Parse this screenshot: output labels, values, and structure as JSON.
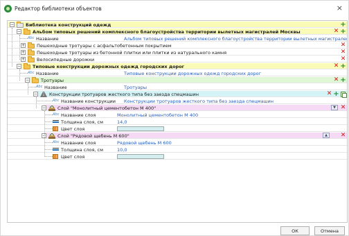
{
  "window": {
    "title": "Редактор библиотеки объектов",
    "close_glyph": "×",
    "app_icon": "app-globe-icon"
  },
  "tree": {
    "root": {
      "label": "Библиотека конструкций одежд",
      "expander": "−"
    },
    "album": {
      "label": "Альбом типовых решений комплексного благоустройства территории вылетных магистралей Москвы",
      "expander": "−"
    },
    "album_name": {
      "label": "Название",
      "value": "Альбом типовых решений комплексного благоустройства территории вылетных магистралей Москвы"
    },
    "group1": {
      "label": "Пешеходные тротуары с асфальтобетонным покрытием",
      "expander": "+"
    },
    "group2": {
      "label": "Пешеходные тротуары из бетонной плитки или плитки из натурального камня",
      "expander": "+"
    },
    "group3": {
      "label": "Велосипедные дорожки",
      "expander": "+"
    },
    "typical": {
      "label": "Типовые конструкции дорожных одежд городских дорог",
      "expander": "−"
    },
    "typical_name": {
      "label": "Название",
      "value": "Типовые конструкции дорожных одежд городских дорог"
    },
    "sidewalks": {
      "label": "Тротуары",
      "expander": "−"
    },
    "sidewalks_name": {
      "label": "Название",
      "value": "Тротуары"
    },
    "construction": {
      "label": "Конструкции тротуаров жесткого типа без заезда спецмашин",
      "expander": "−"
    },
    "construction_name": {
      "label": "Название конструкции",
      "value": "Конструкции тротуаров жесткого типа без заезда спецмашин"
    },
    "layer1": {
      "label": "Слой \"Монолитный цементобетон М 400\"",
      "expander": "−"
    },
    "layer1_name": {
      "label": "Название слоя",
      "value": "Монолитный цементобетон М 400"
    },
    "layer1_thickness": {
      "label": "Толщина слоя, см",
      "value": "14,0"
    },
    "layer1_color": {
      "label": "Цвет слоя",
      "swatch": "#d6eef0"
    },
    "layer2": {
      "label": "Слой \"Рядовой щебень М 600\"",
      "expander": "−"
    },
    "layer2_name": {
      "label": "Название слоя",
      "value": "Рядовой щебень М 600"
    },
    "layer2_thickness": {
      "label": "Толщина слоя, см",
      "value": "10,0"
    },
    "layer2_color": {
      "label": "Цвет слоя",
      "swatch": "#d6eef0"
    }
  },
  "actions": {
    "delete_glyph": "✕",
    "add_glyph": "+",
    "up_glyph": "▲",
    "down_glyph": "▼"
  },
  "abc_label": "Abc",
  "footer": {
    "ok": "ОК",
    "cancel": "Отмена"
  },
  "colors": {
    "album_bar": "#fbfbb8",
    "sidewalks_bar": "#dff7d4",
    "construction_bar": "#d4f3f7",
    "layer_bar": "#f6d9f4",
    "delete": "#d21a1a",
    "add": "#1e9a2a",
    "value_text": "#2a5db8"
  }
}
